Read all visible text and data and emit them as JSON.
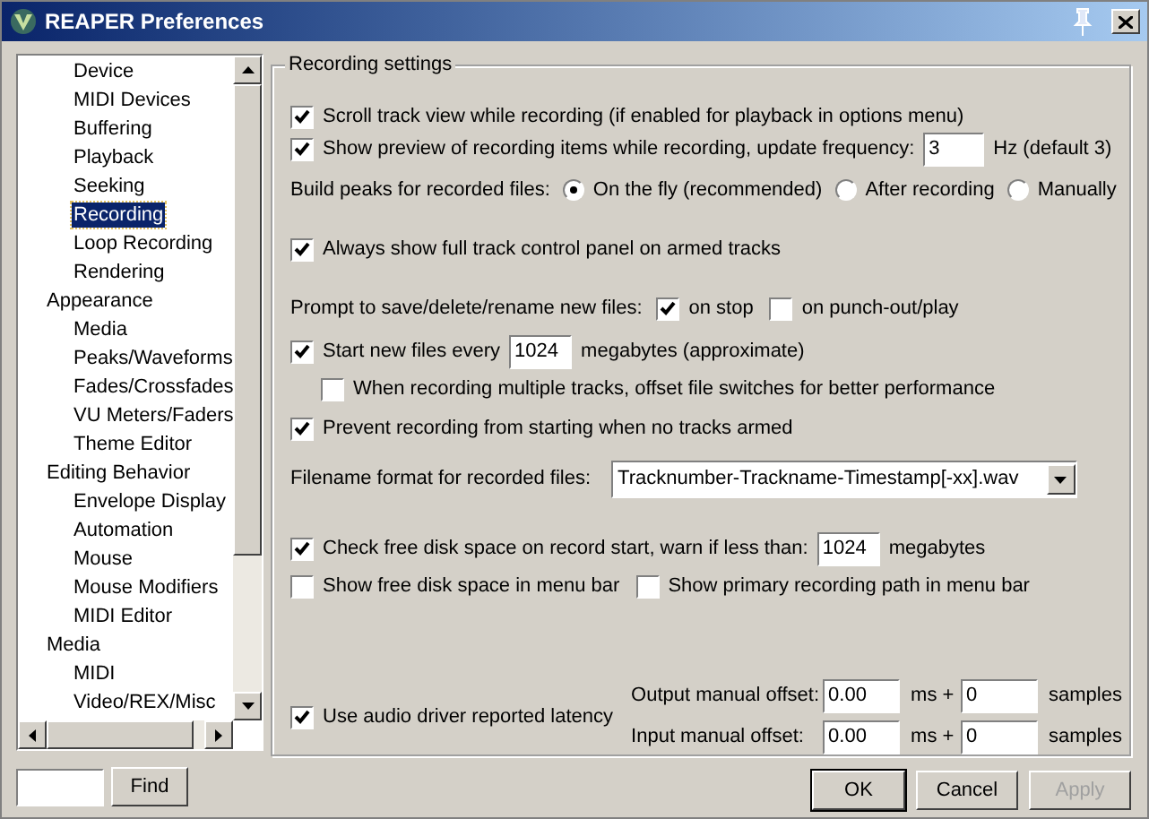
{
  "window": {
    "title": "REAPER Preferences"
  },
  "tree": [
    {
      "children": [
        {
          "label": "Device",
          "selected": false
        },
        {
          "label": "MIDI Devices",
          "selected": false
        },
        {
          "label": "Buffering",
          "selected": false
        },
        {
          "label": "Playback",
          "selected": false
        },
        {
          "label": "Seeking",
          "selected": false
        },
        {
          "label": "Recording",
          "selected": true
        },
        {
          "label": "Loop Recording",
          "selected": false
        },
        {
          "label": "Rendering",
          "selected": false
        }
      ]
    },
    {
      "label": "Appearance",
      "selected": false,
      "children": [
        {
          "label": "Media",
          "selected": false
        },
        {
          "label": "Peaks/Waveforms",
          "selected": false
        },
        {
          "label": "Fades/Crossfades",
          "selected": false
        },
        {
          "label": "VU Meters/Faders",
          "selected": false
        },
        {
          "label": "Theme Editor",
          "selected": false
        }
      ]
    },
    {
      "label": "Editing Behavior",
      "selected": false,
      "children": [
        {
          "label": "Envelope Display",
          "selected": false
        },
        {
          "label": "Automation",
          "selected": false
        },
        {
          "label": "Mouse",
          "selected": false
        },
        {
          "label": "Mouse Modifiers",
          "selected": false
        },
        {
          "label": "MIDI Editor",
          "selected": false
        }
      ]
    },
    {
      "label": "Media",
      "selected": false,
      "children": [
        {
          "label": "MIDI",
          "selected": false
        },
        {
          "label": "Video/REX/Misc",
          "selected": false
        }
      ]
    }
  ],
  "find_button": "Find",
  "group": {
    "title": "Recording settings",
    "rows": [
      {
        "kind": "check",
        "label": "Scroll track view while recording (if enabled for playback in options menu)",
        "checked": true
      },
      {
        "kind": "check_field",
        "label": "Show preview of recording items while recording, update frequency:",
        "checked": true,
        "value": "3",
        "suffix": "Hz (default 3)"
      },
      {
        "kind": "radios",
        "label": "Build peaks for recorded files:",
        "options": [
          {
            "label": "On the fly (recommended)",
            "selected": true
          },
          {
            "label": "After recording",
            "selected": false
          },
          {
            "label": "Manually",
            "selected": false
          }
        ]
      },
      {
        "kind": "check",
        "label": "Always show full track control panel on armed tracks",
        "checked": true
      },
      {
        "kind": "label_checks",
        "label": "Prompt to save/delete/rename new files:",
        "options": [
          {
            "label": "on stop",
            "checked": true
          },
          {
            "label": "on punch-out/play",
            "checked": false
          }
        ]
      },
      {
        "kind": "check_field",
        "label": "Start new files every",
        "checked": true,
        "value": "1024",
        "suffix": "megabytes (approximate)"
      },
      {
        "kind": "check",
        "label": "When recording multiple tracks, offset file switches for better performance",
        "checked": false,
        "indented": true
      },
      {
        "kind": "check",
        "label": "Prevent recording from starting when no tracks armed",
        "checked": true
      },
      {
        "kind": "dropdown",
        "label": "Filename format for recorded files:",
        "value": "Tracknumber-Trackname-Timestamp[-xx].wav"
      },
      {
        "kind": "check_field",
        "label": "Check free disk space on record start, warn if less than:",
        "checked": true,
        "value": "1024",
        "suffix": "megabytes"
      },
      {
        "kind": "checks",
        "options": [
          {
            "label": "Show free disk space in menu bar",
            "checked": false
          },
          {
            "label": "Show primary recording path in menu bar",
            "checked": false
          }
        ]
      },
      {
        "kind": "latency",
        "label": "Use audio driver reported latency",
        "checked": true,
        "offsets": [
          {
            "label": "Output manual offset:",
            "ms": "0.00",
            "ms_unit": "ms +",
            "samples": "0",
            "samples_unit": "samples"
          },
          {
            "label": "Input manual offset:",
            "ms": "0.00",
            "ms_unit": "ms +",
            "samples": "0",
            "samples_unit": "samples"
          }
        ]
      }
    ]
  },
  "buttons": [
    {
      "label": "OK",
      "disabled": false
    },
    {
      "label": "Cancel",
      "disabled": false
    },
    {
      "label": "Apply",
      "disabled": true
    }
  ]
}
